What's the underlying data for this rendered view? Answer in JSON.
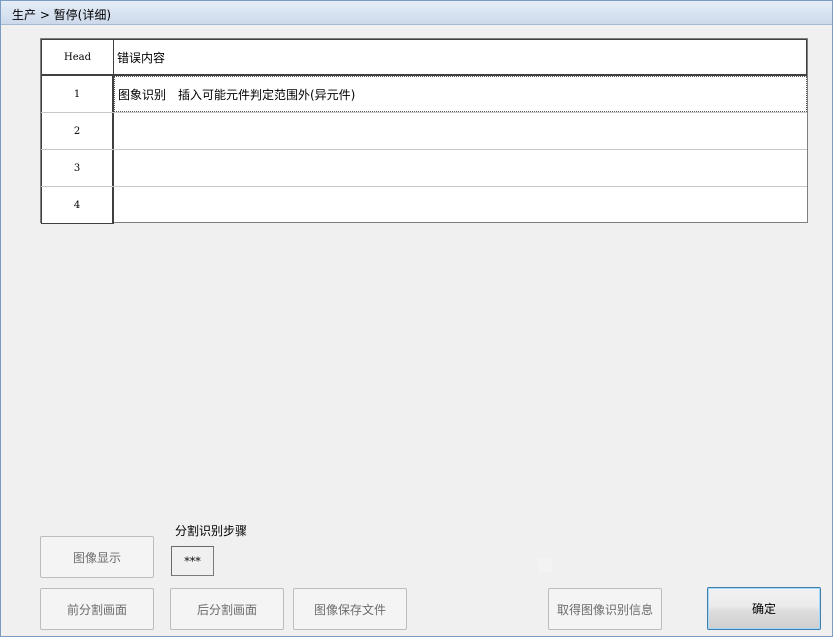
{
  "window": {
    "title": "生产 > 暂停(详细)"
  },
  "grid": {
    "header": {
      "head": "Head",
      "content": "错误内容"
    },
    "rows": [
      {
        "num": "1",
        "content": "图象识别　插入可能元件判定范围外(异元件)"
      },
      {
        "num": "2",
        "content": ""
      },
      {
        "num": "3",
        "content": ""
      },
      {
        "num": "4",
        "content": ""
      }
    ]
  },
  "step": {
    "label": "分割识别步骤",
    "value": "***"
  },
  "buttons": {
    "image_display": "图像显示",
    "prev_split": "前分割画面",
    "next_split": "后分割画面",
    "save_image": "图像保存文件",
    "get_recognition": "取得图像识别信息",
    "ok": "确定"
  }
}
